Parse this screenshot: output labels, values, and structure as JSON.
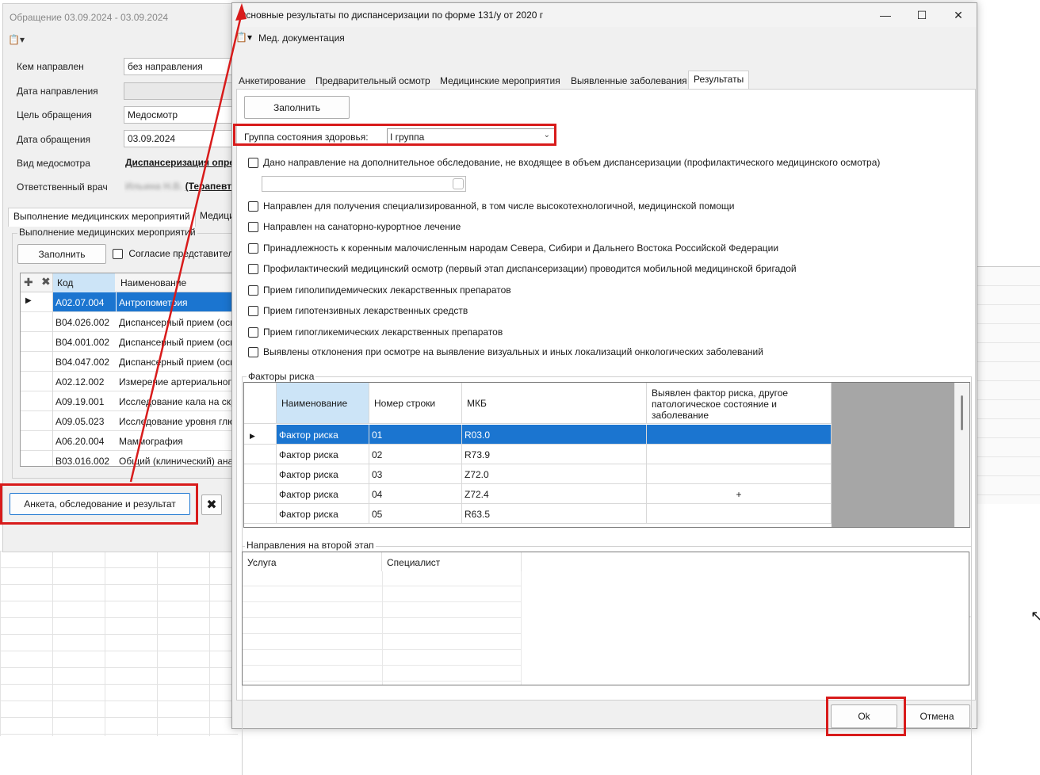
{
  "background_window": {
    "title": "Обращение 03.09.2024 - 03.09.2024",
    "form": [
      {
        "label": "Кем направлен",
        "value": "без направления"
      },
      {
        "label": "Дата направления",
        "value": ""
      },
      {
        "label": "Цель обращения",
        "value": "Медосмотр"
      },
      {
        "label": "Дата обращения",
        "value": "03.09.2024"
      },
      {
        "label": "Вид медосмотра",
        "value": "Диспансеризация опре"
      },
      {
        "label": "Ответственный врач",
        "value_blurred": "Ильина Н.В.",
        "value": "(Терапевт у"
      }
    ],
    "tabs": [
      "Выполнение медицинских мероприятий",
      "Медици"
    ],
    "group_title": "Выполнение медицинских мероприятий",
    "fill_button": "Заполнить",
    "consent_label": "Согласие представителя",
    "grid": {
      "columns": [
        "Код",
        "Наименование"
      ],
      "rows": [
        {
          "code": "A02.07.004",
          "name": "Антропометрия"
        },
        {
          "code": "B04.026.002",
          "name": "Диспансерный прием (осм"
        },
        {
          "code": "B04.001.002",
          "name": "Диспансерный прием (осм"
        },
        {
          "code": "B04.047.002",
          "name": "Диспансерный прием (осм"
        },
        {
          "code": "A02.12.002",
          "name": "Измерение артериального"
        },
        {
          "code": "A09.19.001",
          "name": "Исследование кала на скр"
        },
        {
          "code": "A09.05.023",
          "name": "Исследование уровня глю"
        },
        {
          "code": "A06.20.004",
          "name": "Маммография"
        },
        {
          "code": "B03.016.002",
          "name": "Общий (клинический) ана"
        }
      ]
    },
    "survey_button": "Анкета, обследование и результат"
  },
  "dialog": {
    "title": "Основные результаты по диспансеризации по форме 131/у от 2020 г",
    "menu_item": "Мед. документация",
    "tabs": [
      "Анкетирование",
      "Предварительный осмотр",
      "Медицинские мероприятия",
      "Выявленные заболевания",
      "Результаты"
    ],
    "fill_button": "Заполнить",
    "health_group_label": "Группа состояния здоровья:",
    "health_group_value": "I группа",
    "checkboxes": [
      "Дано направление на дополнительное обследование, не входящее в объем диспансеризации (профилактического медицинского осмотра)",
      "Направлен для получения специализированной, в том числе высокотехнологичной, медицинской помощи",
      "Направлен на санаторно-курортное лечение",
      "Принадлежность к коренным малочисленным народам Севера, Сибири и Дальнего Востока Российской Федерации",
      "Профилактический медицинский осмотр (первый этап диспансеризации) проводится мобильной медицинской бригадой",
      "Прием гиполипидемических лекарственных препаратов",
      "Прием гипотензивных лекарственных средств",
      "Прием гипогликемических лекарственных препаратов",
      "Выявлены отклонения при осмотре на выявление визуальных и иных локализаций онкологических заболеваний"
    ],
    "risk_factors": {
      "title": "Факторы риска",
      "columns": [
        "Наименование",
        "Номер строки",
        "МКБ",
        "Выявлен фактор риска, другое патологическое состояние и заболевание"
      ],
      "rows": [
        {
          "name": "Фактор риска",
          "line": "01",
          "mkb": "R03.0",
          "found": ""
        },
        {
          "name": "Фактор риска",
          "line": "02",
          "mkb": "R73.9",
          "found": ""
        },
        {
          "name": "Фактор риска",
          "line": "03",
          "mkb": "Z72.0",
          "found": ""
        },
        {
          "name": "Фактор риска",
          "line": "04",
          "mkb": "Z72.4",
          "found": "+"
        },
        {
          "name": "Фактор риска",
          "line": "05",
          "mkb": "R63.5",
          "found": ""
        }
      ]
    },
    "second_stage": {
      "title": "Направления на второй этап",
      "columns": [
        "Услуга",
        "Специалист"
      ]
    },
    "ok_button": "Ok",
    "cancel_button": "Отмена"
  },
  "colors": {
    "selection": "#1b75d0",
    "header_highlight": "#cce4f7",
    "annotation_red": "#d81b1b"
  }
}
